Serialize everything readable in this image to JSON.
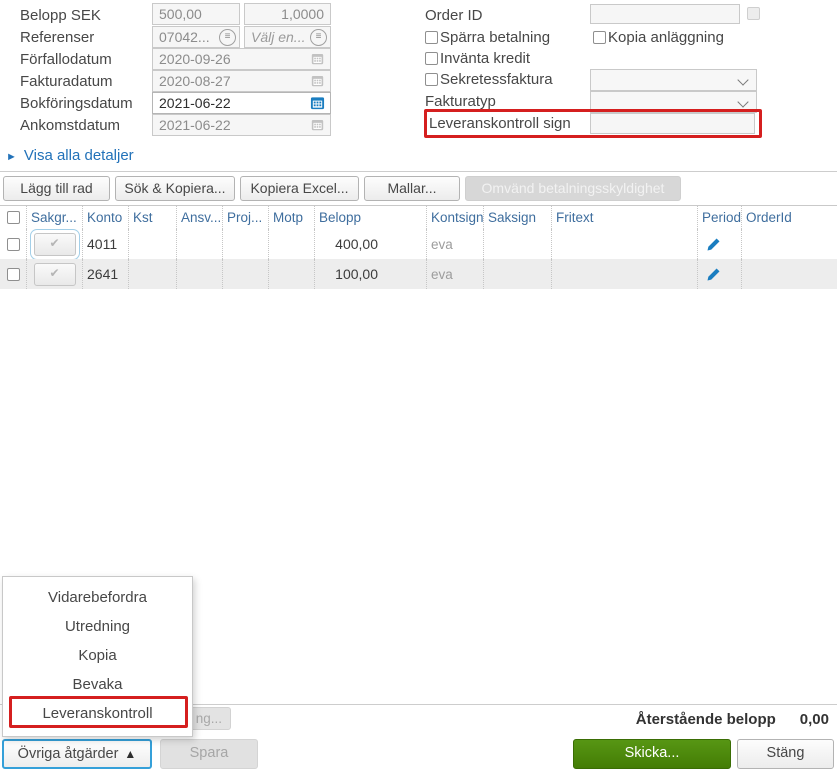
{
  "colors": {
    "accent_blue": "#2f9fdb",
    "link_blue": "#2272b9",
    "table_header_blue": "#3f6e9e",
    "pencil_blue": "#1a7dc0",
    "highlight_red": "#d51f1f",
    "action_green": "#4a8a0c"
  },
  "icons": {
    "checkmark": "✔",
    "menu_up_arrow": "▲",
    "link_arrow": "►",
    "hamburger": "≡"
  },
  "form_left": {
    "belopp_sek": {
      "label": "Belopp SEK",
      "amount": "500,00",
      "rate": "1,0000"
    },
    "referenser": {
      "label": "Referenser",
      "ref1": "07042...",
      "ref2_placeholder": "Välj en..."
    },
    "forfallodatum": {
      "label": "Förfallodatum",
      "value": "2020-09-26"
    },
    "fakturadatum": {
      "label": "Fakturadatum",
      "value": "2020-08-27"
    },
    "bokforingsdatum": {
      "label": "Bokföringsdatum",
      "value": "2021-06-22"
    },
    "ankomstdatum": {
      "label": "Ankomstdatum",
      "value": "2021-06-22"
    },
    "visa_alla_detaljer": "Visa alla detaljer"
  },
  "form_right": {
    "order_id_label": "Order ID",
    "sparra_betalning": "Spärra betalning",
    "kopia_anlaggning": "Kopia anläggning",
    "invanta_kredit": "Invänta kredit",
    "sekretessfaktura": "Sekretessfaktura",
    "fakturatyp": "Fakturatyp",
    "leveranskontroll_sign": "Leveranskontroll sign"
  },
  "toolbar": {
    "lagg_till_rad": "Lägg till rad",
    "sok_kopiera": "Sök & Kopiera...",
    "kopiera_excel": "Kopiera Excel...",
    "mallar": "Mallar...",
    "omvand_betalningsskyldighet": "Omvänd betalningsskyldighet"
  },
  "table": {
    "headers": [
      "Sakgr...",
      "Konto",
      "Kst",
      "Ansv...",
      "Proj...",
      "Motp",
      "Belopp",
      "Kontsign",
      "Saksign",
      "Fritext",
      "Period",
      "OrderId"
    ],
    "rows": [
      {
        "konto": "4011",
        "belopp": "400,00",
        "kontsign": "eva"
      },
      {
        "konto": "2641",
        "belopp": "100,00",
        "kontsign": "eva"
      }
    ]
  },
  "menu": {
    "items": [
      "Vidarebefordra",
      "Utredning",
      "Kopia",
      "Bevaka",
      "Leveranskontroll"
    ]
  },
  "footer": {
    "partial_button": "ng...",
    "aterstaende_label": "Återstående belopp",
    "aterstaende_value": "0,00",
    "ovriga_atgarder": "Övriga åtgärder",
    "spara": "Spara",
    "skicka": "Skicka...",
    "stang": "Stäng"
  }
}
